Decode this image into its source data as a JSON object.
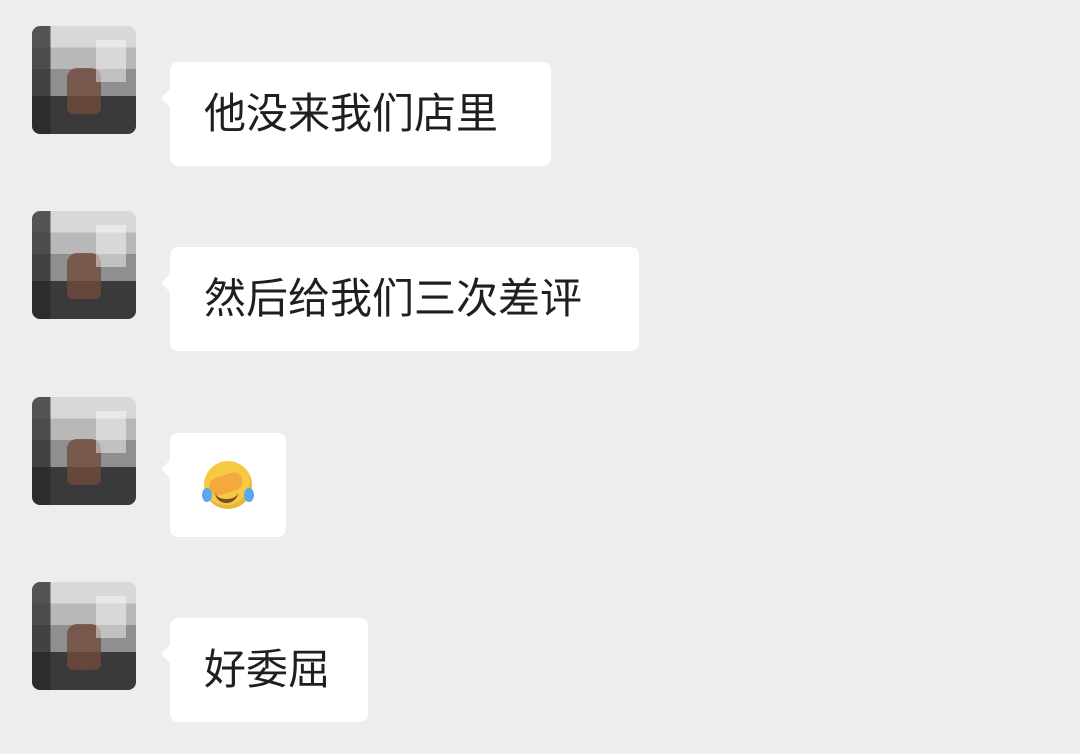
{
  "messages": [
    {
      "text": "他没来我们店里",
      "sender_name": "",
      "avatar_icon": "user-avatar"
    },
    {
      "text": "然后给我们三次差评",
      "sender_name": "",
      "avatar_icon": "user-avatar"
    },
    {
      "text": "",
      "emoji": "crying-face-palm-emoji",
      "sender_name": "",
      "avatar_icon": "user-avatar"
    },
    {
      "text": "好委屈",
      "sender_name": "",
      "avatar_icon": "user-avatar"
    }
  ],
  "colors": {
    "background": "#ededed",
    "bubble": "#ffffff",
    "text": "#1f1f1f",
    "name": "#a7a7a7"
  }
}
